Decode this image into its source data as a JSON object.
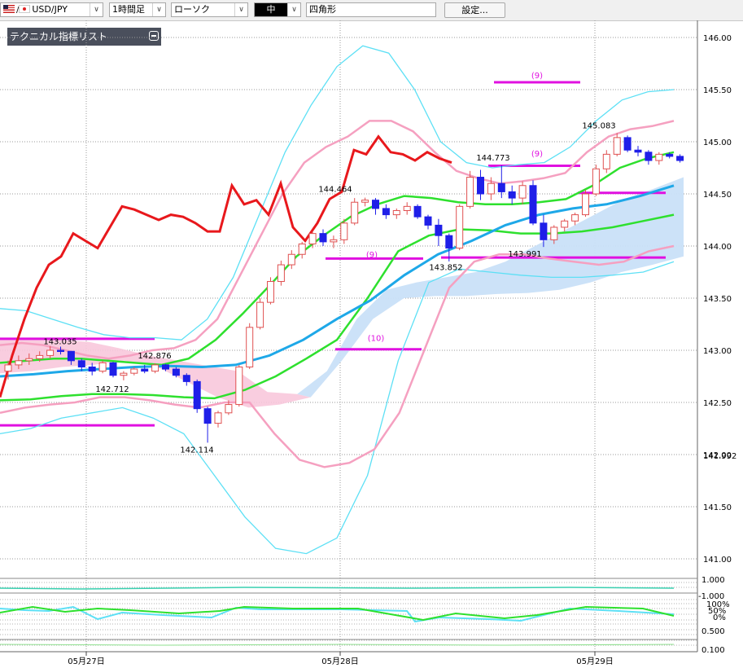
{
  "toolbar": {
    "symbol": "USD/JPY",
    "timeframe": "1時間足",
    "chart_style": "ローソク",
    "size": "中",
    "drawing_tool": "四角形",
    "settings_button": "設定..."
  },
  "indicator_panel": {
    "title": "テクニカル指標リスト"
  },
  "colors": {
    "up_candle": "#e05050",
    "down_candle": "#1f1fe8",
    "red_line": "#e8181c",
    "pink_band": "#f5a0c0",
    "cyan_band": "#5de0f5",
    "green_ma": "#2ee02e",
    "blue_ma": "#1ea8e8",
    "cloud_blue": "#c9e0f8",
    "cloud_pink": "#f8c8dc",
    "magenta_box": "#e010e0"
  },
  "chart_data": {
    "type": "candlestick",
    "title": "",
    "y_axis_ticks": [
      "146.00",
      "145.50",
      "145.00",
      "144.50",
      "144.00",
      "143.50",
      "143.00",
      "142.50",
      "142.00",
      "141.50",
      "141.00"
    ],
    "ylim": [
      140.9,
      146.05
    ],
    "x_axis_ticks": [
      "05月27日",
      "05月28日",
      "05月29日"
    ],
    "price_labels": [
      "143.035",
      "142.876",
      "142.712",
      "142.114",
      "144.464",
      "143.852",
      "144.773",
      "143.991",
      "145.083"
    ],
    "box_labels": [
      "(9)",
      "(10)",
      "(9)",
      "(9)"
    ],
    "right_markers": [
      "141.992",
      "142.00"
    ],
    "sub_panel_ticks": [
      "1.000",
      "-1.000",
      "100%",
      "50%",
      "0%",
      "0.500",
      "0.100"
    ],
    "candles": [
      [
        142.8,
        142.9,
        142.72,
        142.86
      ],
      [
        142.86,
        142.95,
        142.82,
        142.9
      ],
      [
        142.9,
        142.97,
        142.86,
        142.92
      ],
      [
        142.92,
        142.99,
        142.89,
        142.95
      ],
      [
        142.95,
        143.04,
        142.92,
        143.0
      ],
      [
        143.0,
        143.035,
        142.96,
        142.99
      ],
      [
        142.99,
        142.99,
        142.86,
        142.9
      ],
      [
        142.9,
        142.92,
        142.8,
        142.84
      ],
      [
        142.84,
        142.88,
        142.76,
        142.8
      ],
      [
        142.8,
        142.9,
        142.78,
        142.88
      ],
      [
        142.88,
        142.89,
        142.74,
        142.76
      ],
      [
        142.76,
        142.8,
        142.712,
        142.78
      ],
      [
        142.78,
        142.84,
        142.76,
        142.82
      ],
      [
        142.82,
        142.86,
        142.78,
        142.8
      ],
      [
        142.8,
        142.876,
        142.78,
        142.86
      ],
      [
        142.86,
        142.87,
        142.8,
        142.82
      ],
      [
        142.82,
        142.84,
        142.74,
        142.76
      ],
      [
        142.76,
        142.78,
        142.66,
        142.7
      ],
      [
        142.7,
        142.72,
        142.4,
        142.44
      ],
      [
        142.44,
        142.46,
        142.114,
        142.3
      ],
      [
        142.3,
        142.42,
        142.26,
        142.4
      ],
      [
        142.4,
        142.52,
        142.38,
        142.48
      ],
      [
        142.48,
        142.86,
        142.46,
        142.84
      ],
      [
        142.84,
        143.26,
        142.82,
        143.22
      ],
      [
        143.22,
        143.5,
        143.2,
        143.46
      ],
      [
        143.46,
        143.7,
        143.44,
        143.66
      ],
      [
        143.66,
        143.86,
        143.62,
        143.82
      ],
      [
        143.82,
        143.96,
        143.78,
        143.92
      ],
      [
        143.92,
        144.04,
        143.88,
        144.02
      ],
      [
        144.02,
        144.14,
        143.98,
        144.12
      ],
      [
        144.12,
        144.16,
        144.0,
        144.04
      ],
      [
        144.04,
        144.1,
        143.98,
        144.06
      ],
      [
        144.06,
        144.26,
        144.02,
        144.22
      ],
      [
        144.22,
        144.46,
        144.2,
        144.42
      ],
      [
        144.42,
        144.464,
        144.38,
        144.44
      ],
      [
        144.44,
        144.46,
        144.3,
        144.36
      ],
      [
        144.36,
        144.4,
        144.26,
        144.3
      ],
      [
        144.3,
        144.36,
        144.26,
        144.34
      ],
      [
        144.34,
        144.42,
        144.3,
        144.38
      ],
      [
        144.38,
        144.4,
        144.26,
        144.28
      ],
      [
        144.28,
        144.3,
        144.16,
        144.2
      ],
      [
        144.2,
        144.26,
        144.0,
        144.1
      ],
      [
        144.1,
        144.12,
        143.852,
        143.98
      ],
      [
        143.98,
        144.4,
        143.96,
        144.38
      ],
      [
        144.38,
        144.72,
        144.36,
        144.66
      ],
      [
        144.66,
        144.73,
        144.44,
        144.5
      ],
      [
        144.5,
        144.66,
        144.44,
        144.6
      ],
      [
        144.6,
        144.773,
        144.46,
        144.52
      ],
      [
        144.52,
        144.58,
        144.4,
        144.46
      ],
      [
        144.46,
        144.62,
        144.4,
        144.58
      ],
      [
        144.58,
        144.63,
        144.2,
        144.22
      ],
      [
        144.22,
        144.3,
        143.991,
        144.06
      ],
      [
        144.06,
        144.2,
        144.02,
        144.18
      ],
      [
        144.18,
        144.26,
        144.14,
        144.24
      ],
      [
        144.24,
        144.32,
        144.2,
        144.3
      ],
      [
        144.3,
        144.54,
        144.28,
        144.5
      ],
      [
        144.5,
        144.78,
        144.48,
        144.74
      ],
      [
        144.74,
        144.92,
        144.7,
        144.88
      ],
      [
        144.88,
        145.083,
        144.86,
        145.04
      ],
      [
        145.04,
        145.06,
        144.9,
        144.92
      ],
      [
        144.92,
        144.96,
        144.86,
        144.9
      ],
      [
        144.9,
        144.92,
        144.78,
        144.82
      ],
      [
        144.82,
        144.9,
        144.78,
        144.88
      ],
      [
        144.88,
        144.9,
        144.84,
        144.86
      ],
      [
        144.86,
        144.88,
        144.8,
        144.82
      ]
    ],
    "overlays": {
      "red_line": [
        142.55,
        142.95,
        143.3,
        143.6,
        143.82,
        143.9,
        144.12,
        144.05,
        143.98,
        144.18,
        144.38,
        144.35,
        144.3,
        144.25,
        144.3,
        144.28,
        144.22,
        144.14,
        144.14,
        144.58,
        144.4,
        144.44,
        144.3,
        144.6,
        144.18,
        144.05,
        144.22,
        144.45,
        144.52,
        144.92,
        144.88,
        145.05,
        144.9,
        144.88,
        144.82,
        144.9,
        144.84,
        144.8
      ],
      "pink_upper": [
        143.05,
        143.07,
        143.05,
        143.0,
        142.95,
        142.92,
        142.95,
        143.0,
        143.02,
        143.1,
        143.3,
        143.7,
        144.1,
        144.5,
        144.8,
        144.95,
        145.05,
        145.2,
        145.2,
        145.1,
        144.9,
        144.72,
        144.65,
        144.6,
        144.62,
        144.65,
        144.7,
        144.9,
        145.05,
        145.12,
        145.15,
        145.2
      ],
      "pink_lower": [
        142.4,
        142.45,
        142.48,
        142.5,
        142.55,
        142.55,
        142.52,
        142.48,
        142.45,
        142.5,
        142.5,
        142.2,
        141.95,
        141.88,
        141.92,
        142.05,
        142.4,
        143.0,
        143.6,
        143.85,
        143.92,
        143.92,
        143.88,
        143.85,
        143.82,
        143.85,
        143.95,
        144.0
      ],
      "cyan_upper": [
        143.4,
        143.38,
        143.3,
        143.22,
        143.15,
        143.12,
        143.12,
        143.1,
        143.3,
        143.7,
        144.3,
        144.9,
        145.35,
        145.72,
        145.92,
        145.85,
        145.5,
        145.0,
        144.8,
        144.75,
        144.78,
        144.8,
        144.95,
        145.2,
        145.4,
        145.48,
        145.5
      ],
      "cyan_lower": [
        142.2,
        142.25,
        142.35,
        142.4,
        142.45,
        142.35,
        142.2,
        141.8,
        141.4,
        141.1,
        141.05,
        141.2,
        141.8,
        142.9,
        143.65,
        143.78,
        143.75,
        143.72,
        143.7,
        143.7,
        143.72,
        143.75,
        143.85
      ],
      "green_upper": [
        142.88,
        142.9,
        142.92,
        142.92,
        142.9,
        142.88,
        142.86,
        142.92,
        143.1,
        143.35,
        143.62,
        143.9,
        144.1,
        144.28,
        144.4,
        144.48,
        144.46,
        144.42,
        144.4,
        144.4,
        144.42,
        144.45,
        144.58,
        144.75,
        144.84,
        144.9
      ],
      "green_lower": [
        142.52,
        142.53,
        142.56,
        142.58,
        142.58,
        142.57,
        142.55,
        142.54,
        142.62,
        142.75,
        142.92,
        143.1,
        143.5,
        143.95,
        144.1,
        144.16,
        144.15,
        144.12,
        144.12,
        144.14,
        144.18,
        144.24,
        144.3
      ],
      "blue_ma": [
        142.75,
        142.77,
        142.8,
        142.82,
        142.84,
        142.85,
        142.84,
        142.86,
        142.95,
        143.1,
        143.3,
        143.48,
        143.72,
        143.92,
        144.05,
        144.2,
        144.3,
        144.36,
        144.4,
        144.48,
        144.58
      ]
    }
  }
}
